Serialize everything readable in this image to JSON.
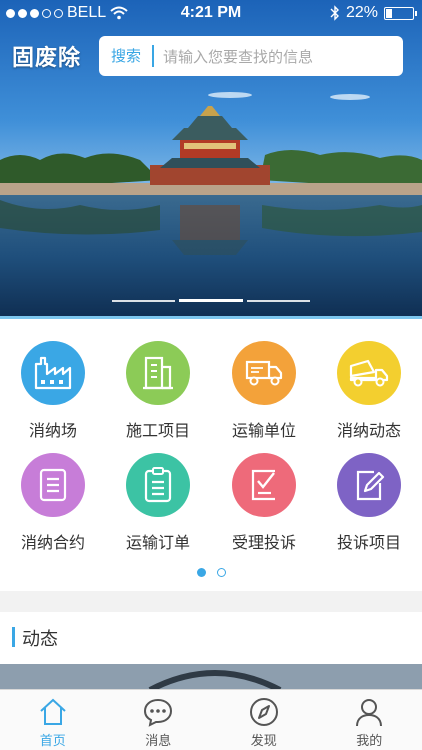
{
  "status_bar": {
    "carrier": "BELL",
    "time": "4:21 PM",
    "battery": "22%"
  },
  "header": {
    "brand": "固废除",
    "search_label": "搜索",
    "search_placeholder": "请输入您要查找的信息"
  },
  "banner": {
    "slides": 3,
    "active": 1
  },
  "grid": {
    "items": [
      {
        "label": "消纳场",
        "color": "#3aa7e5",
        "icon": "factory-icon"
      },
      {
        "label": "施工项目",
        "color": "#8ccb57",
        "icon": "building-icon"
      },
      {
        "label": "运输单位",
        "color": "#f3a23a",
        "icon": "truck-icon"
      },
      {
        "label": "消纳动态",
        "color": "#f3cf2f",
        "icon": "dump-truck-icon"
      },
      {
        "label": "消纳合约",
        "color": "#c77dd8",
        "icon": "document-icon"
      },
      {
        "label": "运输订单",
        "color": "#3cc3a4",
        "icon": "clipboard-icon"
      },
      {
        "label": "受理投诉",
        "color": "#ee6a7a",
        "icon": "check-form-icon"
      },
      {
        "label": "投诉项目",
        "color": "#7e63c5",
        "icon": "edit-icon"
      }
    ],
    "page": 1,
    "pages": 2
  },
  "news": {
    "title": "动态"
  },
  "tabbar": {
    "tabs": [
      {
        "label": "首页",
        "icon": "home-icon",
        "active": true
      },
      {
        "label": "消息",
        "icon": "message-icon",
        "active": false
      },
      {
        "label": "发现",
        "icon": "compass-icon",
        "active": false
      },
      {
        "label": "我的",
        "icon": "user-icon",
        "active": false
      }
    ]
  },
  "colors": {
    "accent": "#3aa7e5"
  }
}
